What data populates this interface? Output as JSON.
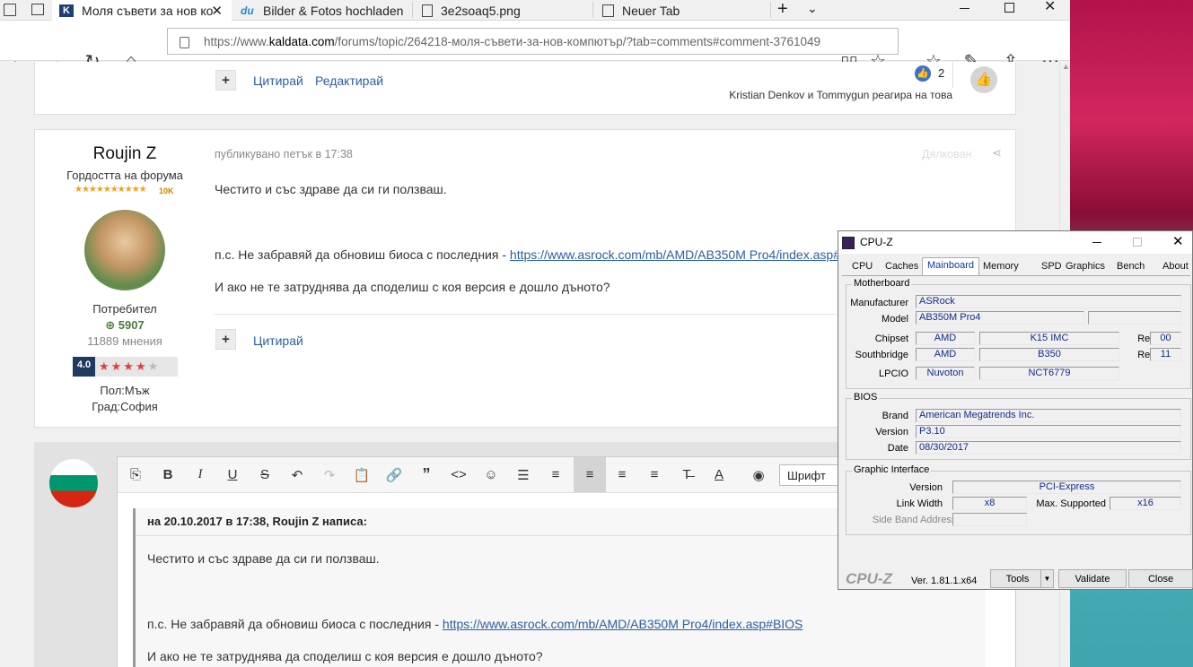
{
  "browser": {
    "tabs": [
      {
        "label": "Моля съвети за нов ко"
      },
      {
        "label": "Bilder & Fotos hochladen"
      },
      {
        "label": "3e2soaq5.png"
      },
      {
        "label": "Neuer Tab"
      }
    ],
    "url_prefix": "https://www.",
    "url_domain": "kaldata.com",
    "url_rest": "/forums/topic/264218-моля-съвети-за-нов-компютър/?tab=comments#comment-3761049"
  },
  "post1": {
    "quote_label": "Цитирай",
    "edit_label": "Редактирай",
    "reaction_count": "2",
    "reaction_text": "Kristian Denkov и Tommygun реагира на това"
  },
  "post2": {
    "author": "Roujin Z",
    "rank": "Гордостта на форума",
    "rank_badge": "10K",
    "group": "Потребител",
    "reputation": "5907",
    "posts": "11889 мнения",
    "rating": "4.0",
    "gender": "Пол:Мъж",
    "city": "Град:София",
    "date": "публикувано петък в 17:38",
    "share_label": "Дялкован",
    "line1": "Честито и със здраве да си ги ползваш.",
    "line2_prefix": "п.с. Не забравяй да обновиш биоса с последния - ",
    "line2_link": "https://www.asrock.com/mb/AMD/AB350M Pro4/index.asp#BIOS",
    "line3": "И ако не те затруднява да споделиш с коя версия е дошло дъното?",
    "quote_label": "Цитирай"
  },
  "editor": {
    "font_label": "Шрифт",
    "quote_header": "на 20.10.2017 в 17:38, Roujin Z написа:",
    "line1": "Честито и със здраве да си ги ползваш.",
    "line2_prefix": "п.с. Не забравяй да обновиш биоса с последния - ",
    "line2_link": "https://www.asrock.com/mb/AMD/AB350M Pro4/index.asp#BIOS",
    "line3": "И ако не те затруднява да споделиш с коя версия е дошло дъното?"
  },
  "cpuz": {
    "title": "CPU-Z",
    "tabs": [
      "CPU",
      "Caches",
      "Mainboard",
      "Memory",
      "SPD",
      "Graphics",
      "Bench",
      "About"
    ],
    "motherboard_label": "Motherboard",
    "manufacturer_label": "Manufacturer",
    "manufacturer": "ASRock",
    "model_label": "Model",
    "model": "AB350M Pro4",
    "chipset_label": "Chipset",
    "chipset_vendor": "AMD",
    "chipset_model": "K15 IMC",
    "chipset_rev_label": "Rev.",
    "chipset_rev": "00",
    "southbridge_label": "Southbridge",
    "sb_vendor": "AMD",
    "sb_model": "B350",
    "sb_rev_label": "Rev.",
    "sb_rev": "11",
    "lpcio_label": "LPCIO",
    "lpcio_vendor": "Nuvoton",
    "lpcio_model": "NCT6779",
    "bios_label": "BIOS",
    "brand_label": "Brand",
    "brand": "American Megatrends Inc.",
    "version_label": "Version",
    "version": "P3.10",
    "date_label": "Date",
    "date": "08/30/2017",
    "gi_label": "Graphic Interface",
    "gi_version_label": "Version",
    "gi_version": "PCI-Express",
    "link_width_label": "Link Width",
    "link_width": "x8",
    "max_supported_label": "Max. Supported",
    "max_supported": "x16",
    "sideband_label": "Side Band Addressing",
    "logo": "CPU-Z",
    "ver": "Ver. 1.81.1.x64",
    "tools_label": "Tools",
    "validate_label": "Validate",
    "close_label": "Close"
  },
  "colors": {
    "link": "#2a5fa3",
    "cpuz_value": "#122a8a",
    "tab_active": "#ffffff"
  }
}
